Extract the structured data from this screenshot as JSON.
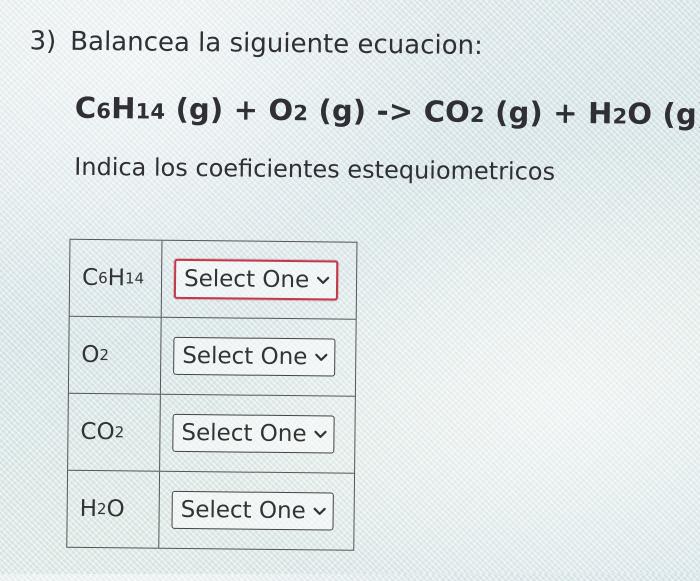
{
  "question": {
    "number": "3)",
    "title": "Balancea la siguiente ecuacion:"
  },
  "equation": {
    "t1_main": "C",
    "t1_a": "6",
    "t1_b": "H",
    "t1_c": "14",
    "t1_state": " (g) + O",
    "t2_sub": "2",
    "t2_state": " (g) -> CO",
    "t3_sub": "2",
    "t3_state": " (g) + H",
    "t4_sub": "2",
    "t4_state": "O (g)"
  },
  "instruction": "Indica los coeficientes estequiometricos",
  "rows": [
    {
      "formula_main": "C",
      "formula_sub1": "6",
      "formula_mid": "H",
      "formula_sub2": "14",
      "formula_end": "",
      "select_value": "Select One"
    },
    {
      "formula_main": "O",
      "formula_sub1": "2",
      "formula_mid": "",
      "formula_sub2": "",
      "formula_end": "",
      "select_value": "Select One"
    },
    {
      "formula_main": "CO",
      "formula_sub1": "2",
      "formula_mid": "",
      "formula_sub2": "",
      "formula_end": "",
      "select_value": "Select One"
    },
    {
      "formula_main": "H",
      "formula_sub1": "2",
      "formula_mid": "O",
      "formula_sub2": "",
      "formula_end": "",
      "select_value": "Select One"
    }
  ],
  "colors": {
    "text": "#2f2f35",
    "focus_border": "#c03a4c",
    "table_border": "#555555"
  },
  "icons": {
    "dropdown": "chevron-down-icon"
  }
}
